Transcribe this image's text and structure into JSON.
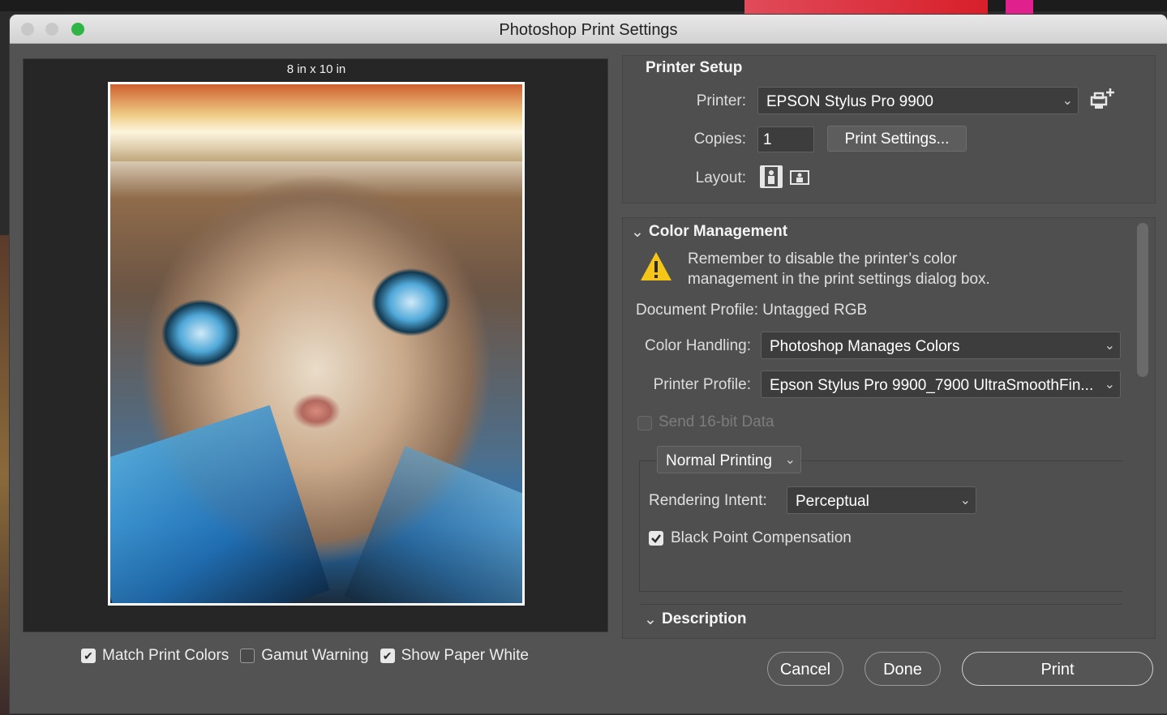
{
  "window": {
    "title": "Photoshop Print Settings"
  },
  "preview": {
    "paper_size": "8 in x 10 in"
  },
  "preview_options": {
    "match_print_colors": {
      "label": "Match Print Colors",
      "checked": true
    },
    "gamut_warning": {
      "label": "Gamut Warning",
      "checked": false
    },
    "show_paper_white": {
      "label": "Show Paper White",
      "checked": true
    }
  },
  "printer_setup": {
    "title": "Printer Setup",
    "printer_label": "Printer:",
    "printer_value": "EPSON Stylus Pro 9900",
    "copies_label": "Copies:",
    "copies_value": "1",
    "print_settings_button": "Print Settings...",
    "layout_label": "Layout:"
  },
  "color_management": {
    "title": "Color Management",
    "warning_line1": "Remember to disable the printer’s color",
    "warning_line2": "management in the print settings dialog box.",
    "document_profile": "Document Profile: Untagged RGB",
    "color_handling_label": "Color Handling:",
    "color_handling_value": "Photoshop Manages Colors",
    "printer_profile_label": "Printer Profile:",
    "printer_profile_value": "Epson Stylus Pro 9900_7900 UltraSmoothFin...",
    "send_16bit": {
      "label": "Send 16-bit Data",
      "checked": false,
      "enabled": false
    },
    "printing_mode": "Normal Printing",
    "rendering_intent_label": "Rendering Intent:",
    "rendering_intent_value": "Perceptual",
    "black_point": {
      "label": "Black Point Compensation",
      "checked": true
    }
  },
  "description": {
    "title": "Description"
  },
  "buttons": {
    "cancel": "Cancel",
    "done": "Done",
    "print": "Print"
  },
  "icons": {
    "chevron": "⌄",
    "check": "✔",
    "warning": "!"
  },
  "colors": {
    "accent_green": "#2fb545",
    "warning_yellow": "#f5c518"
  }
}
